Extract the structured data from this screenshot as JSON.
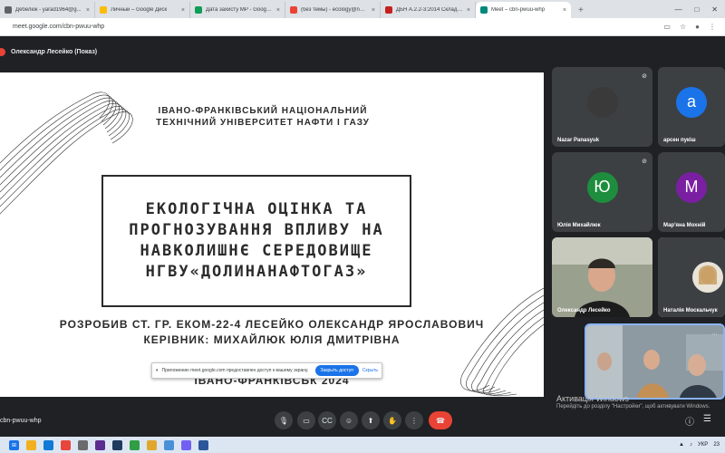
{
  "browser": {
    "tabs": [
      {
        "title": "Дебелюк - yarad1964@g...",
        "color": "#5f6368"
      },
      {
        "title": "Личный – Google Диск",
        "color": "#fbbc04"
      },
      {
        "title": "Дата захисту МР - Google Tab...",
        "color": "#0f9d58"
      },
      {
        "title": "(без темы) - ecology@nung.e...",
        "color": "#ea4335"
      },
      {
        "title": "ДБН А.2.2-3:2014 Склад та зм...",
        "color": "#c5221f"
      },
      {
        "title": "Meet – cbn-pwuu-whp",
        "color": "#00897b",
        "active": true
      }
    ],
    "url": "meet.google.com/cbn-pwuu-whp",
    "new_tab": "+",
    "close_glyph": "×"
  },
  "presenter": {
    "label": "Олександр Лесейко (Показ)"
  },
  "slide": {
    "university": "ІВАНО-ФРАНКІВСЬКИЙ НАЦІОНАЛЬНИЙ ТЕХНІЧНИЙ УНІВЕРСИТЕТ НАФТИ І ГАЗУ",
    "title": "ЕКОЛОГІЧНА ОЦІНКА ТА ПРОГНОЗУВАННЯ ВПЛИВУ НА НАВКОЛИШНЄ СЕРЕДОВИЩЕ НГВУ«ДОЛИНАНАФТОГАЗ»",
    "author": "РОЗРОБИВ СТ. ГР. ЕКОМ-22-4 ЛЕСЕЙКО ОЛЕКСАНДР ЯРОСЛАВОВИЧ",
    "supervisor": "КЕРІВНИК: МИХАЙЛЮК ЮЛІЯ ДМИТРІВНА",
    "city": "ІВАНО-ФРАНКІВСЬК 2024"
  },
  "share_banner": {
    "text": "Приложению meet.google.com предоставлен доступ к вашему экрану.",
    "stop": "Закрыть доступ",
    "hide": "Скрыть"
  },
  "participants": [
    {
      "name": "Nazar Panasyuk",
      "initial": "",
      "color": "#3a3a3a"
    },
    {
      "name": "арсен пукіш",
      "initial": "а",
      "color": "#1a73e8"
    },
    {
      "name": "Юлія Михайлюк",
      "initial": "Ю",
      "color": "#1e8e3e"
    },
    {
      "name": "Мар'яна Мохній",
      "initial": "М",
      "color": "#7b1fa2"
    },
    {
      "name": "Олександр Лесейко",
      "initial": "",
      "color": "#5b6e4e"
    },
    {
      "name": "Наталія Москальчук",
      "initial": "",
      "color": "#e9e3d8"
    }
  ],
  "meeting_code": "cbn-pwuu-whp",
  "activation": {
    "line1": "Активація Windows",
    "line2": "Перейдіть до розділу \"Настройки\", щоб активувати Windows."
  },
  "taskbar": {
    "lang": "УКР",
    "time": "23"
  }
}
